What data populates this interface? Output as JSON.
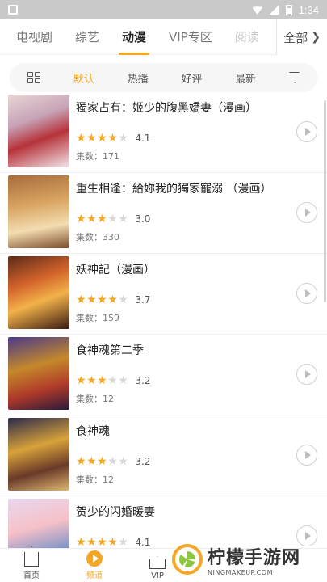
{
  "status_bar": {
    "time": "1:34"
  },
  "top_tabs": [
    {
      "label": "电视剧"
    },
    {
      "label": "综艺"
    },
    {
      "label": "动漫",
      "active": true
    },
    {
      "label": "VIP专区"
    },
    {
      "label": "阅读"
    }
  ],
  "all_button": {
    "label": "全部"
  },
  "filters": {
    "items": [
      "默认",
      "热播",
      "好评",
      "最新"
    ],
    "active": "默认"
  },
  "items": [
    {
      "title": "獨家占有：姬少的腹黑嬌妻（漫画）",
      "rating": "4.1",
      "stars": 4,
      "episodes": "集数：171"
    },
    {
      "title": "重生相逢：給妳我的獨家寵溺 （漫画）",
      "rating": "3.0",
      "stars": 3,
      "episodes": "集数：330"
    },
    {
      "title": "妖神記（漫画）",
      "rating": "3.7",
      "stars": 4,
      "episodes": "集数：159"
    },
    {
      "title": "食神魂第二季",
      "rating": "3.2",
      "stars": 3,
      "episodes": "集数：12"
    },
    {
      "title": "食神魂",
      "rating": "3.2",
      "stars": 3,
      "episodes": "集数：12"
    },
    {
      "title": "贺少的闪婚暖妻",
      "rating": "4.1",
      "stars": 4,
      "episodes": ""
    }
  ],
  "bottom_nav": [
    {
      "label": "首页"
    },
    {
      "label": "频道"
    },
    {
      "label": "VIP"
    }
  ],
  "watermark": {
    "cn": "柠檬手游网",
    "en": "NINGMAKEUP.COM"
  },
  "colors": {
    "accent": "#f5a623",
    "star_empty": "#d8d8d8"
  }
}
